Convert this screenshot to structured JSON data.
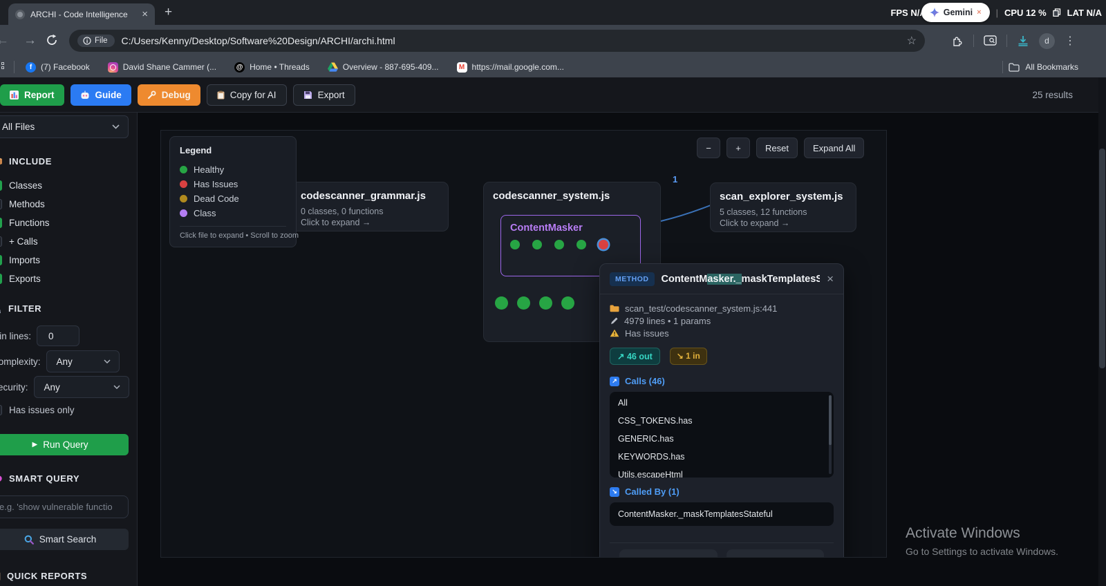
{
  "browser": {
    "tab_title": "ARCHI - Code Intelligence",
    "new_tab_label": "+",
    "hud": {
      "fps_label": "FPS",
      "fps_value": "N/A",
      "gemini_label": "Gemini",
      "gemini_close": "×",
      "cpu_label": "CPU",
      "cpu_value": "12 %",
      "lat_label": "LAT",
      "lat_value": "N/A",
      "separator": "|"
    },
    "file_chip_label": "File",
    "url": "C:/Users/Kenny/Desktop/Software%20Design/ARCHI/archi.html",
    "profile_initial": "d",
    "bookmarks": [
      {
        "label": "(7) Facebook"
      },
      {
        "label": "David Shane Cammer (..."
      },
      {
        "label": "Home • Threads"
      },
      {
        "label": "Overview - 887-695-409..."
      },
      {
        "label": "https://mail.google.com..."
      }
    ],
    "all_bookmarks_label": "All Bookmarks"
  },
  "app_toolbar": {
    "report_label": "Report",
    "guide_label": "Guide",
    "debug_label": "Debug",
    "copy_label": "Copy for AI",
    "export_label": "Export",
    "results_label": "25 results"
  },
  "sidebar": {
    "file_filter_value": "All Files",
    "include": {
      "title": "INCLUDE",
      "items": [
        {
          "label": "Classes",
          "checked": true
        },
        {
          "label": "Methods",
          "checked": false
        },
        {
          "label": "Functions",
          "checked": true
        },
        {
          "label": "+ Calls",
          "checked": false
        },
        {
          "label": "Imports",
          "checked": true
        },
        {
          "label": "Exports",
          "checked": true
        }
      ]
    },
    "filter": {
      "title": "FILTER",
      "min_lines_label": "Min lines:",
      "min_lines_value": "0",
      "complexity_label": "Complexity:",
      "complexity_value": "Any",
      "security_label": "Security:",
      "security_value": "Any",
      "has_issues_label": "Has issues only",
      "has_issues_checked": false,
      "run_query_label": "Run Query"
    },
    "smart_query": {
      "title": "SMART QUERY",
      "placeholder": "e.g. 'show vulnerable functio",
      "search_label": "Smart Search"
    },
    "quick_reports_title": "QUICK REPORTS"
  },
  "canvas": {
    "legend": {
      "title": "Legend",
      "items": [
        {
          "label": "Healthy",
          "color": "#27a544"
        },
        {
          "label": "Has Issues",
          "color": "#d94141"
        },
        {
          "label": "Dead Code",
          "color": "#b08a1e"
        },
        {
          "label": "Class",
          "color": "#b37df2"
        }
      ],
      "hint": "Click file to expand • Scroll to zoom"
    },
    "controls": {
      "zoom_out_label": "−",
      "zoom_in_label": "+",
      "reset_label": "Reset",
      "expand_all_label": "Expand All"
    },
    "edge_count": "1",
    "dot_colors": {
      "green": "#27a544",
      "red": "#d94141"
    },
    "files": [
      {
        "name": "codescanner_grammar.js",
        "stats": "0 classes, 0 functions",
        "hint": "Click to expand →"
      },
      {
        "name": "codescanner_system.js",
        "class_name": "ContentMasker",
        "class_dots": [
          "green",
          "green",
          "green",
          "green",
          "red-selected"
        ],
        "file_dots": [
          "green",
          "green",
          "green",
          "green"
        ]
      },
      {
        "name": "scan_explorer_system.js",
        "stats": "5 classes, 12 functions",
        "hint": "Click to expand →"
      }
    ]
  },
  "popup": {
    "badge": "METHOD",
    "title_pre": "ContentM",
    "title_highlight": "asker._",
    "title_post": "maskTemplatesStateful",
    "path": "scan_test/codescanner_system.js:441",
    "meta": "4979 lines • 1 params",
    "issues": "Has issues",
    "out_badge": "↗ 46 out",
    "in_badge": "↘ 1 in",
    "calls_label": "Calls (46)",
    "calls_icon_glyph": "↗",
    "called_by_icon_glyph": "↘",
    "calls": [
      {
        "label": "All"
      },
      {
        "label": "CSS_TOKENS.has"
      },
      {
        "label": "GENERIC.has"
      },
      {
        "label": "KEYWORDS.has"
      },
      {
        "label": "Utils.escapeHtml"
      }
    ],
    "called_by_label": "Called By (1)",
    "called_by": [
      {
        "label": "ContentMasker._maskTemplatesStateful"
      }
    ]
  },
  "watermark": {
    "title": "Activate Windows",
    "subtitle": "Go to Settings to activate Windows."
  }
}
